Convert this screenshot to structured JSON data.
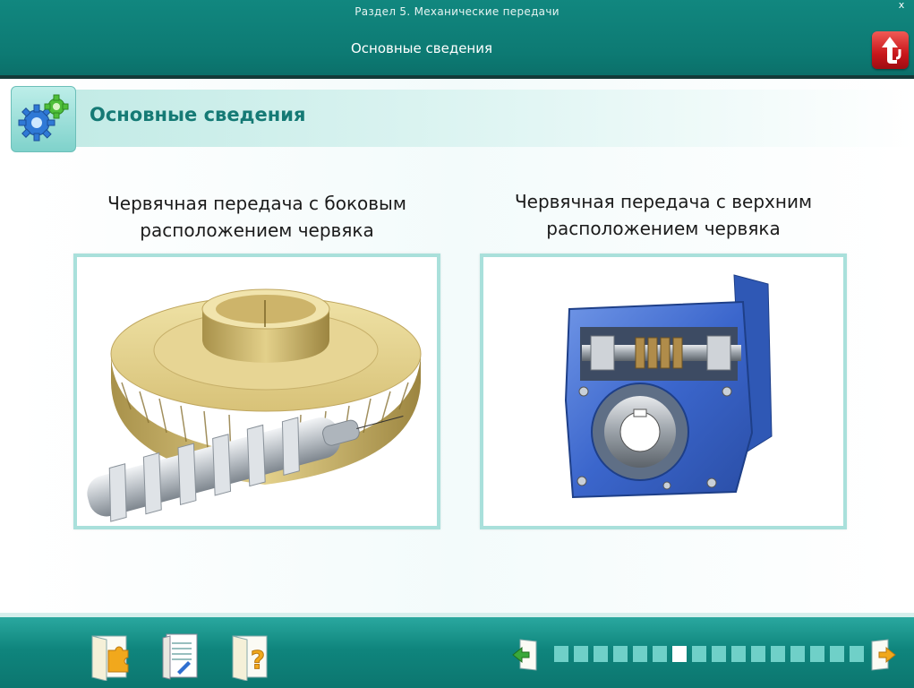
{
  "header": {
    "section_title": "Раздел 5. Механические передачи",
    "page_heading": "Основные сведения",
    "window_close_label": "x"
  },
  "content": {
    "title": "Основные сведения",
    "left": {
      "caption_line1": "Червячная передача с боковым",
      "caption_line2": "расположением червяка"
    },
    "right": {
      "caption_line1": "Червячная передача с верхним",
      "caption_line2": "расположением червяка"
    }
  },
  "footer": {
    "buttons": [
      "puzzle-folder-icon",
      "notebook-icon",
      "help-folder-icon"
    ],
    "progress": {
      "total": 16,
      "current": 7
    }
  },
  "colors": {
    "header_teal": "#0d7a73",
    "title_teal": "#157a75",
    "frame_border": "#a9e0db",
    "progress_dot": "#6fd0c8",
    "up_button_red": "#c8161b"
  }
}
